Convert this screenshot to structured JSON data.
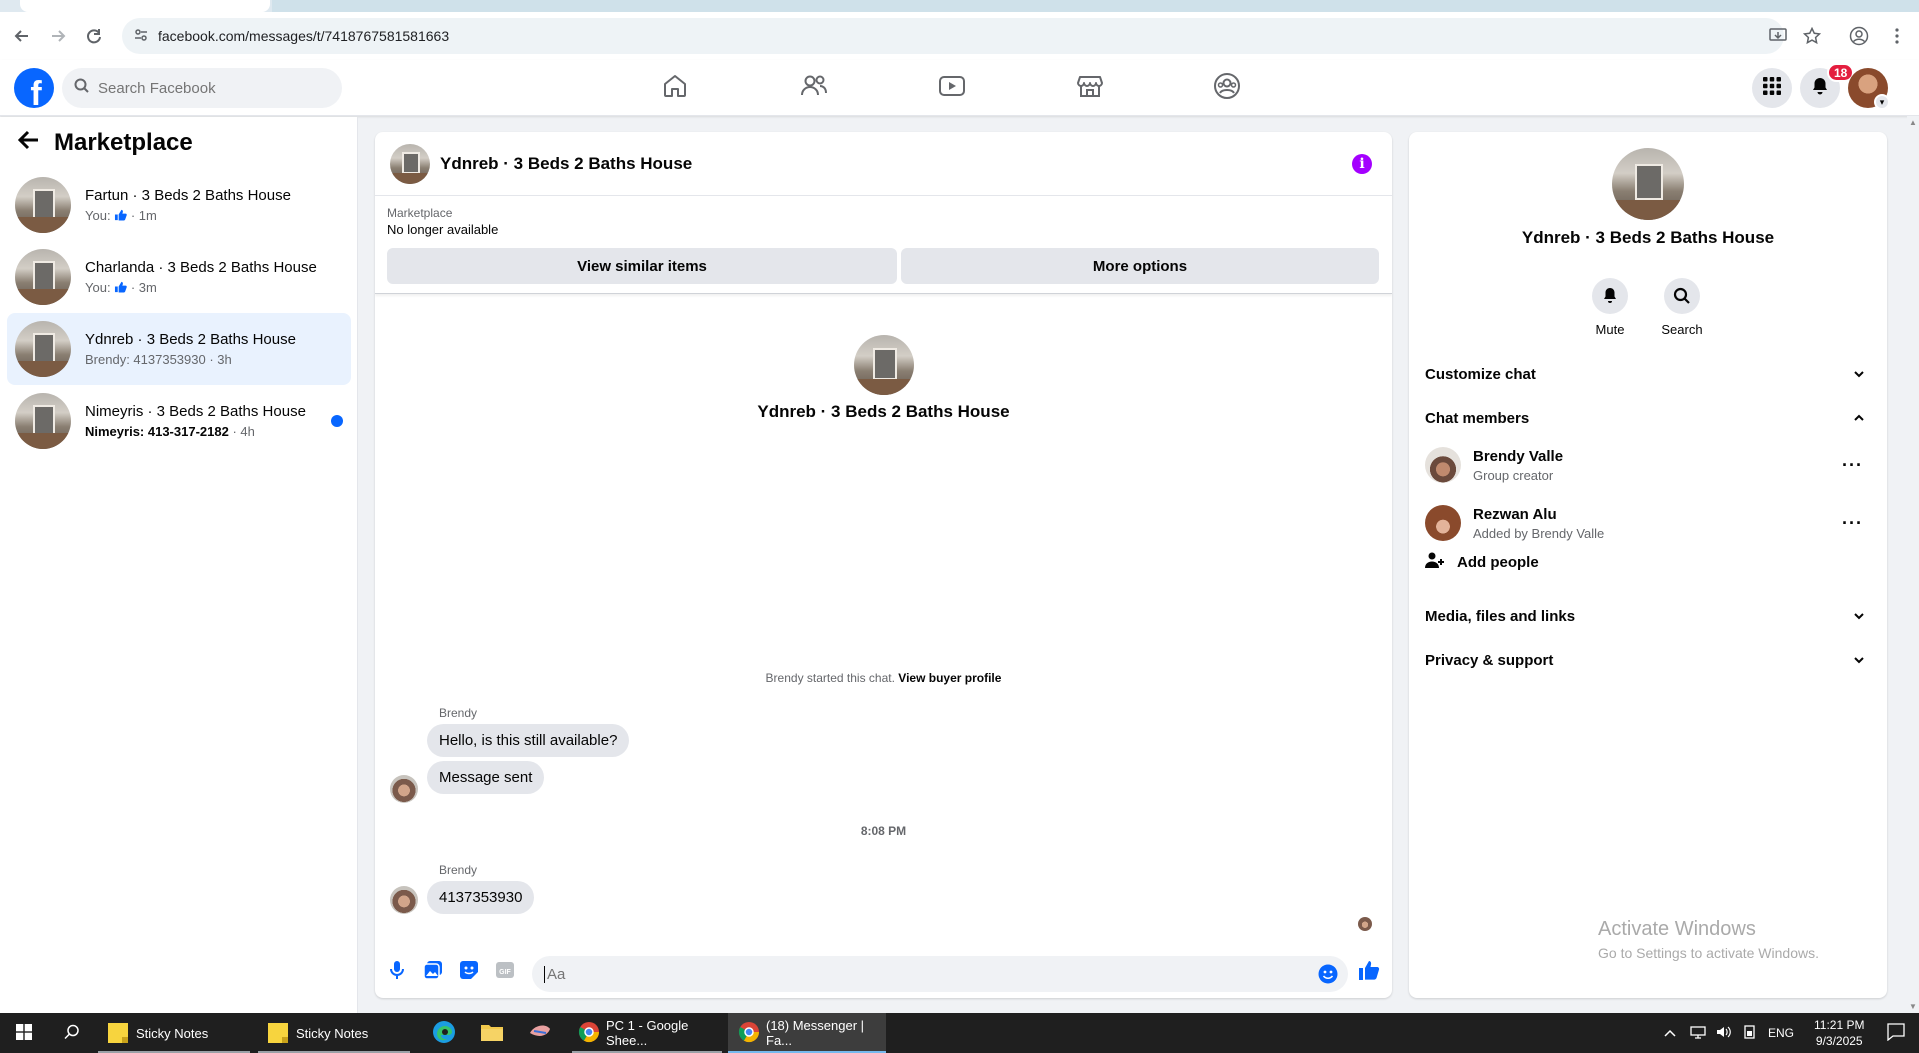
{
  "browser": {
    "url": "facebook.com/messages/t/7418767581581663"
  },
  "header": {
    "search_placeholder": "Search Facebook",
    "notification_count": "18"
  },
  "sidebar": {
    "title": "Marketplace",
    "conversations": [
      {
        "title": "Fartun · 3 Beds 2 Baths House",
        "sub_prefix": "You:",
        "sub_suffix": "· 1m",
        "unread": false
      },
      {
        "title": "Charlanda · 3 Beds 2 Baths House",
        "sub_prefix": "You:",
        "sub_suffix": "· 3m",
        "unread": false
      },
      {
        "title": "Ydnreb · 3 Beds 2 Baths House",
        "sub_prefix": "Brendy: 4137353930",
        "sub_suffix": "· 3h",
        "unread": false,
        "active": true
      },
      {
        "title": "Nimeyris · 3 Beds 2 Baths House",
        "sub_prefix": "Nimeyris: 413-317-2182",
        "sub_suffix": "· 4h",
        "unread": true
      }
    ]
  },
  "chat": {
    "title": "Ydnreb · 3 Beds 2 Baths House",
    "marketplace_label": "Marketplace",
    "listing_status": "No longer available",
    "view_similar_label": "View similar items",
    "more_options_label": "More options",
    "intro_title": "Ydnreb · 3 Beds 2 Baths House",
    "started_text": "Brendy started this chat.",
    "view_buyer_profile": "View buyer profile",
    "messages": [
      {
        "sender": "Brendy",
        "text": "Hello, is this still available?"
      },
      {
        "text": "Message sent"
      },
      {
        "sender": "Brendy",
        "text": "4137353930"
      }
    ],
    "timestamp": "8:08 PM",
    "composer_placeholder": "Aa"
  },
  "details": {
    "title": "Ydnreb · 3 Beds 2 Baths House",
    "mute_label": "Mute",
    "search_label": "Search",
    "customize_chat": "Customize chat",
    "chat_members": "Chat members",
    "members": [
      {
        "name": "Brendy Valle",
        "role": "Group creator"
      },
      {
        "name": "Rezwan Alu",
        "role": "Added by Brendy Valle"
      }
    ],
    "add_people": "Add people",
    "media_files_links": "Media, files and links",
    "privacy_support": "Privacy & support"
  },
  "watermark": {
    "line1": "Activate Windows",
    "line2": "Go to Settings to activate Windows."
  },
  "taskbar": {
    "items": [
      "Sticky Notes",
      "Sticky Notes",
      "PC 1 - Google Shee...",
      "(18) Messenger | Fa..."
    ],
    "language": "ENG",
    "time": "11:21 PM",
    "date": "9/3/2025"
  },
  "colors": {
    "fb_blue": "#0866ff",
    "info_purple": "#a400ff",
    "badge_red": "#e41e3f"
  }
}
